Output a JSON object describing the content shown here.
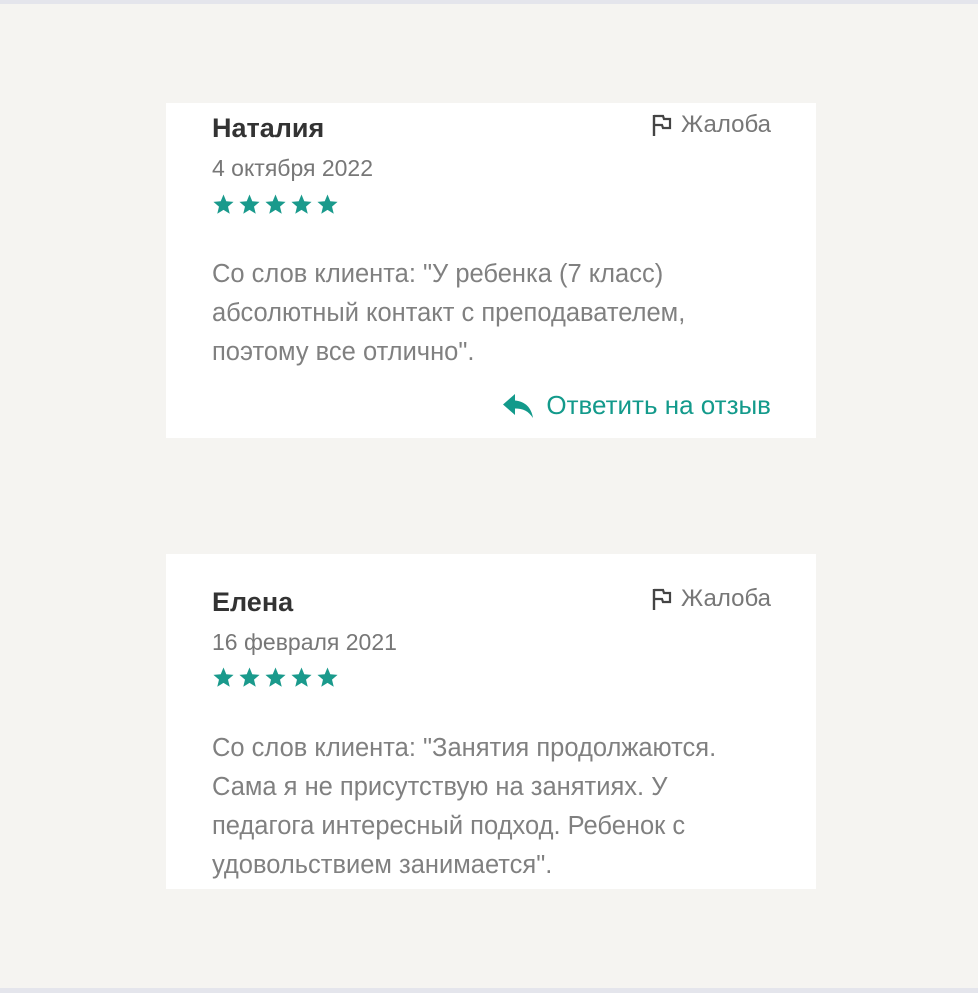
{
  "colors": {
    "background": "#f5f4f1",
    "card": "#ffffff",
    "accent": "#139a8b",
    "star": "#1a9a8c",
    "name": "#333333",
    "muted": "#808080"
  },
  "reviews": [
    {
      "author": "Наталия",
      "date": "4 октября 2022",
      "rating": 5,
      "complaint_label": "Жалоба",
      "text": "Со слов клиента: \"У ребенка (7 класс) абсолютный контакт с преподавателем, поэтому все отлично\".",
      "reply_label": "Ответить на отзыв"
    },
    {
      "author": "Елена",
      "date": "16 февраля 2021",
      "rating": 5,
      "complaint_label": "Жалоба",
      "text": "Со слов клиента: \"Занятия продолжаются. Сама я не присутствую на занятиях. У педагога интересный подход. Ребенок с удовольствием занимается\"."
    }
  ],
  "icons": {
    "complaint": "flag-icon",
    "reply": "reply-arrow-icon",
    "rating": "star-icon"
  }
}
